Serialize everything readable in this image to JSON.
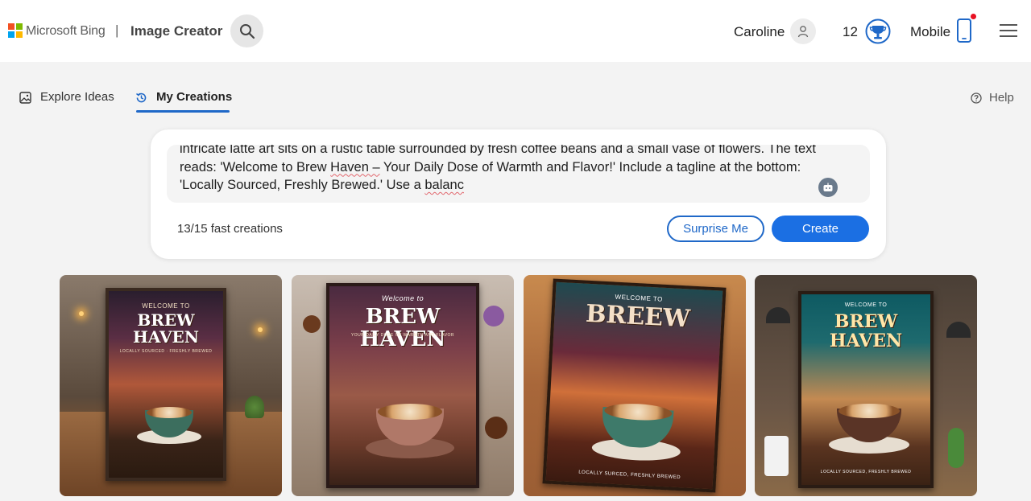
{
  "header": {
    "brand": "Microsoft Bing",
    "separator": "|",
    "app_title": "Image Creator",
    "user_name": "Caroline",
    "points": "12",
    "mobile_label": "Mobile",
    "logo_colors": [
      "#f25022",
      "#7fba00",
      "#00a4ef",
      "#ffb900"
    ]
  },
  "tabs": [
    {
      "label": "Explore Ideas",
      "icon": "image-icon",
      "active": false
    },
    {
      "label": "My Creations",
      "icon": "history-icon",
      "active": true
    }
  ],
  "help_label": "Help",
  "prompt": {
    "line1": "intricate latte art sits on a rustic table surrounded by fresh coffee beans and a small vase of flowers. The text",
    "line2_a": "reads: 'Welcome to Brew ",
    "line2_b": "Haven –",
    "line2_c": " Your Daily Dose of Warmth and Flavor!' Include a tagline at the bottom:",
    "line3_a": "'Locally Sourced, Freshly Brewed.' Use a ",
    "line3_b": "balanc"
  },
  "fast_creations": "13/15 fast creations",
  "buttons": {
    "surprise": "Surprise Me",
    "create": "Create"
  },
  "accent_color": "#1b6fe3",
  "images": [
    {
      "title": "BREW HAVEN",
      "top": "WELCOME TO",
      "sub": "LOCALLY SOURCED · FRESHLY BREWED"
    },
    {
      "title": "BREW HAVEN",
      "top": "Welcome to",
      "sub": "YOUR DAILY DOSE OF WARMTH AND FLAVOR"
    },
    {
      "title": "BREEW",
      "top": "WELCOME TO",
      "sub": "LOCALLY SURCED, FRESHLY BREWED"
    },
    {
      "title": "BREW HAVEN",
      "top": "WELCOME TO",
      "sub": "LOCALLY SOURCED, FRESHLY BREWED"
    }
  ]
}
